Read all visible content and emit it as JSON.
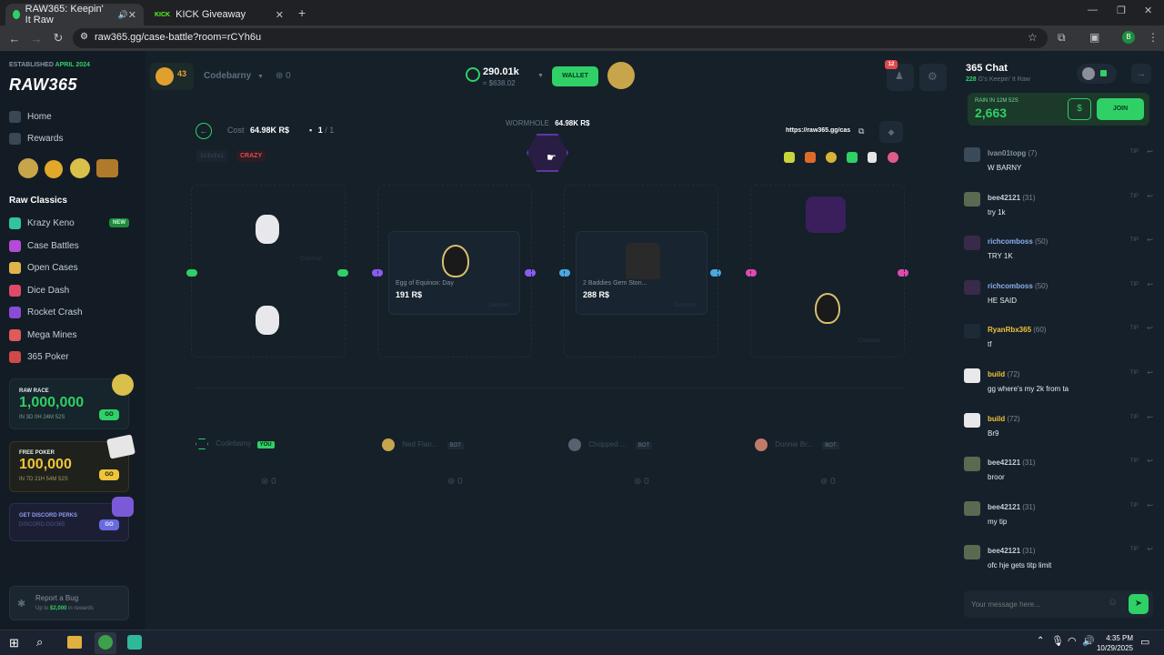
{
  "browser": {
    "tabs": [
      {
        "title": "RAW365: Keepin' It Raw",
        "active": true
      },
      {
        "title": "KICK Giveaway",
        "active": false
      }
    ],
    "url": "raw365.gg/case-battle?room=rCYh6u",
    "profile_initial": "B"
  },
  "sidebar": {
    "established": "ESTABLISHED",
    "established_date": "APRIL 2024",
    "logo": "RAW365",
    "nav": [
      {
        "label": "Home"
      },
      {
        "label": "Rewards"
      }
    ],
    "section_title": "Raw Classics",
    "games": [
      {
        "label": "Krazy Keno",
        "badge": "NEW",
        "color": "#31c4a0"
      },
      {
        "label": "Case Battles",
        "color": "#b44bd6"
      },
      {
        "label": "Open Cases",
        "color": "#e0b44a"
      },
      {
        "label": "Dice Dash",
        "color": "#e04a6a"
      },
      {
        "label": "Rocket Crash",
        "color": "#8a4bd6"
      },
      {
        "label": "Mega Mines",
        "color": "#e05a5a"
      },
      {
        "label": "365 Poker",
        "color": "#d04a4a"
      }
    ],
    "raw_race": {
      "title": "RAW RACE",
      "amount": "1,000,000",
      "timer": "IN 3D 0H 24M 52S",
      "go": "GO"
    },
    "free_poker": {
      "title": "FREE POKER",
      "amount": "100,000",
      "timer": "IN 7D 21H 54M 52S",
      "go": "GO"
    },
    "discord": {
      "title": "GET DISCORD PERKS",
      "sub": "DISCORD.GG/365",
      "go": "GO"
    },
    "report": {
      "title": "Report a Bug",
      "sub_prefix": "Up to",
      "sub_amount": "$2,000",
      "sub_suffix": "in rewards"
    }
  },
  "topbar": {
    "level": "43",
    "username": "Codebarny",
    "user_coins": "0",
    "balance": "290.01k",
    "balance_usd": "≈ $638.02",
    "wallet_label": "WALLET",
    "notifications": "12"
  },
  "battle": {
    "cost_label": "Cost",
    "cost_value": "64.98K R$",
    "cases_current": "1",
    "cases_total": "/ 1",
    "mode_tag": "1v1v1v1",
    "mode_label": "CRAZY",
    "case_name": "WORMHOLE",
    "case_price": "64.98K R$",
    "share_link": "https://raw365.gg/cas",
    "items": [
      {
        "name": "Egg of Equinox: Day",
        "price": "191 R$",
        "rarity": "Common"
      },
      {
        "name": "2 Baddies Gem Ston...",
        "price": "288 R$",
        "rarity": "Common"
      }
    ],
    "side_labels": [
      "Common",
      "Common"
    ],
    "players": [
      {
        "name": "Codebarny",
        "tag": "YOU",
        "total": "0"
      },
      {
        "name": "Ned Flan...",
        "tag": "BOT",
        "total": "0"
      },
      {
        "name": "Chopped ...",
        "tag": "BOT",
        "total": "0"
      },
      {
        "name": "Donnie Br...",
        "tag": "BOT",
        "total": "0"
      }
    ]
  },
  "chat": {
    "title": "365 Chat",
    "online_count": "228",
    "online_label": "G's Keepin' It Raw",
    "rain_label": "RAIN IN",
    "rain_timer": "12M 52S",
    "rain_amount": "2,663",
    "join_label": "JOIN",
    "messages": [
      {
        "user": "Ivan01topg",
        "level": "(7)",
        "text": "W BARNY"
      },
      {
        "user": "bee42121",
        "level": "(31)",
        "text": "try 1k"
      },
      {
        "user": "richcomboss",
        "level": "(50)",
        "text": "TRY 1K"
      },
      {
        "user": "richcomboss",
        "level": "(50)",
        "text": "HE SAID"
      },
      {
        "user": "RyanRbx365",
        "level": "(60)",
        "text": "tf"
      },
      {
        "user": "build",
        "level": "(72)",
        "text": "gg where's my 2k from ta"
      },
      {
        "user": "build",
        "level": "(72)",
        "text": "Br9"
      },
      {
        "user": "bee42121",
        "level": "(31)",
        "text": "broor"
      },
      {
        "user": "bee42121",
        "level": "(31)",
        "text": "my tip"
      },
      {
        "user": "bee42121",
        "level": "(31)",
        "text": "ofc hje gets titp limit"
      }
    ],
    "tip_label": "TIP",
    "input_placeholder": "Your message here..."
  },
  "taskbar": {
    "time": "4:35 PM",
    "date": "10/29/2025"
  },
  "colors": {
    "green": "#2fd066",
    "purple": "#8a5cf0",
    "accent_red": "#e04a4a"
  }
}
